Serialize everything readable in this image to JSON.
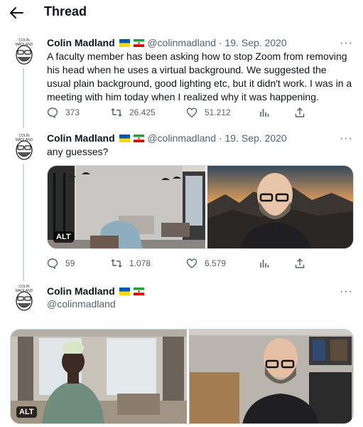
{
  "header": {
    "title": "Thread",
    "back_icon": "arrow-left-icon"
  },
  "tweets": [
    {
      "name": "Colin Madland",
      "handle": "@colinmadland",
      "sep": "·",
      "date": "19. Sep. 2020",
      "text": "A faculty member has been asking how to stop Zoom from removing his head when he uses a virtual background. We suggested the usual plain background, good lighting etc, but it didn't work. I was in a meeting with him today when I realized why it was happening.",
      "replies": "373",
      "retweets": "26.425",
      "likes": "51.212"
    },
    {
      "name": "Colin Madland",
      "handle": "@colinmadland",
      "sep": "·",
      "date": "19. Sep. 2020",
      "text": "any guesses?",
      "alt": "ALT",
      "replies": "59",
      "retweets": "1.078",
      "likes": "6.579"
    },
    {
      "name": "Colin Madland",
      "handle": "@colinmadland",
      "alt": "ALT"
    }
  ],
  "avatar_label": "COLIN MADLAND",
  "icons": [
    "reply-icon",
    "retweet-icon",
    "like-icon",
    "analytics-icon",
    "share-icon",
    "more-icon"
  ],
  "colors": {
    "muted": "#536471",
    "line": "#cfd9de",
    "flag_blue": "#0057b7",
    "flag_yellow": "#ffd700"
  }
}
